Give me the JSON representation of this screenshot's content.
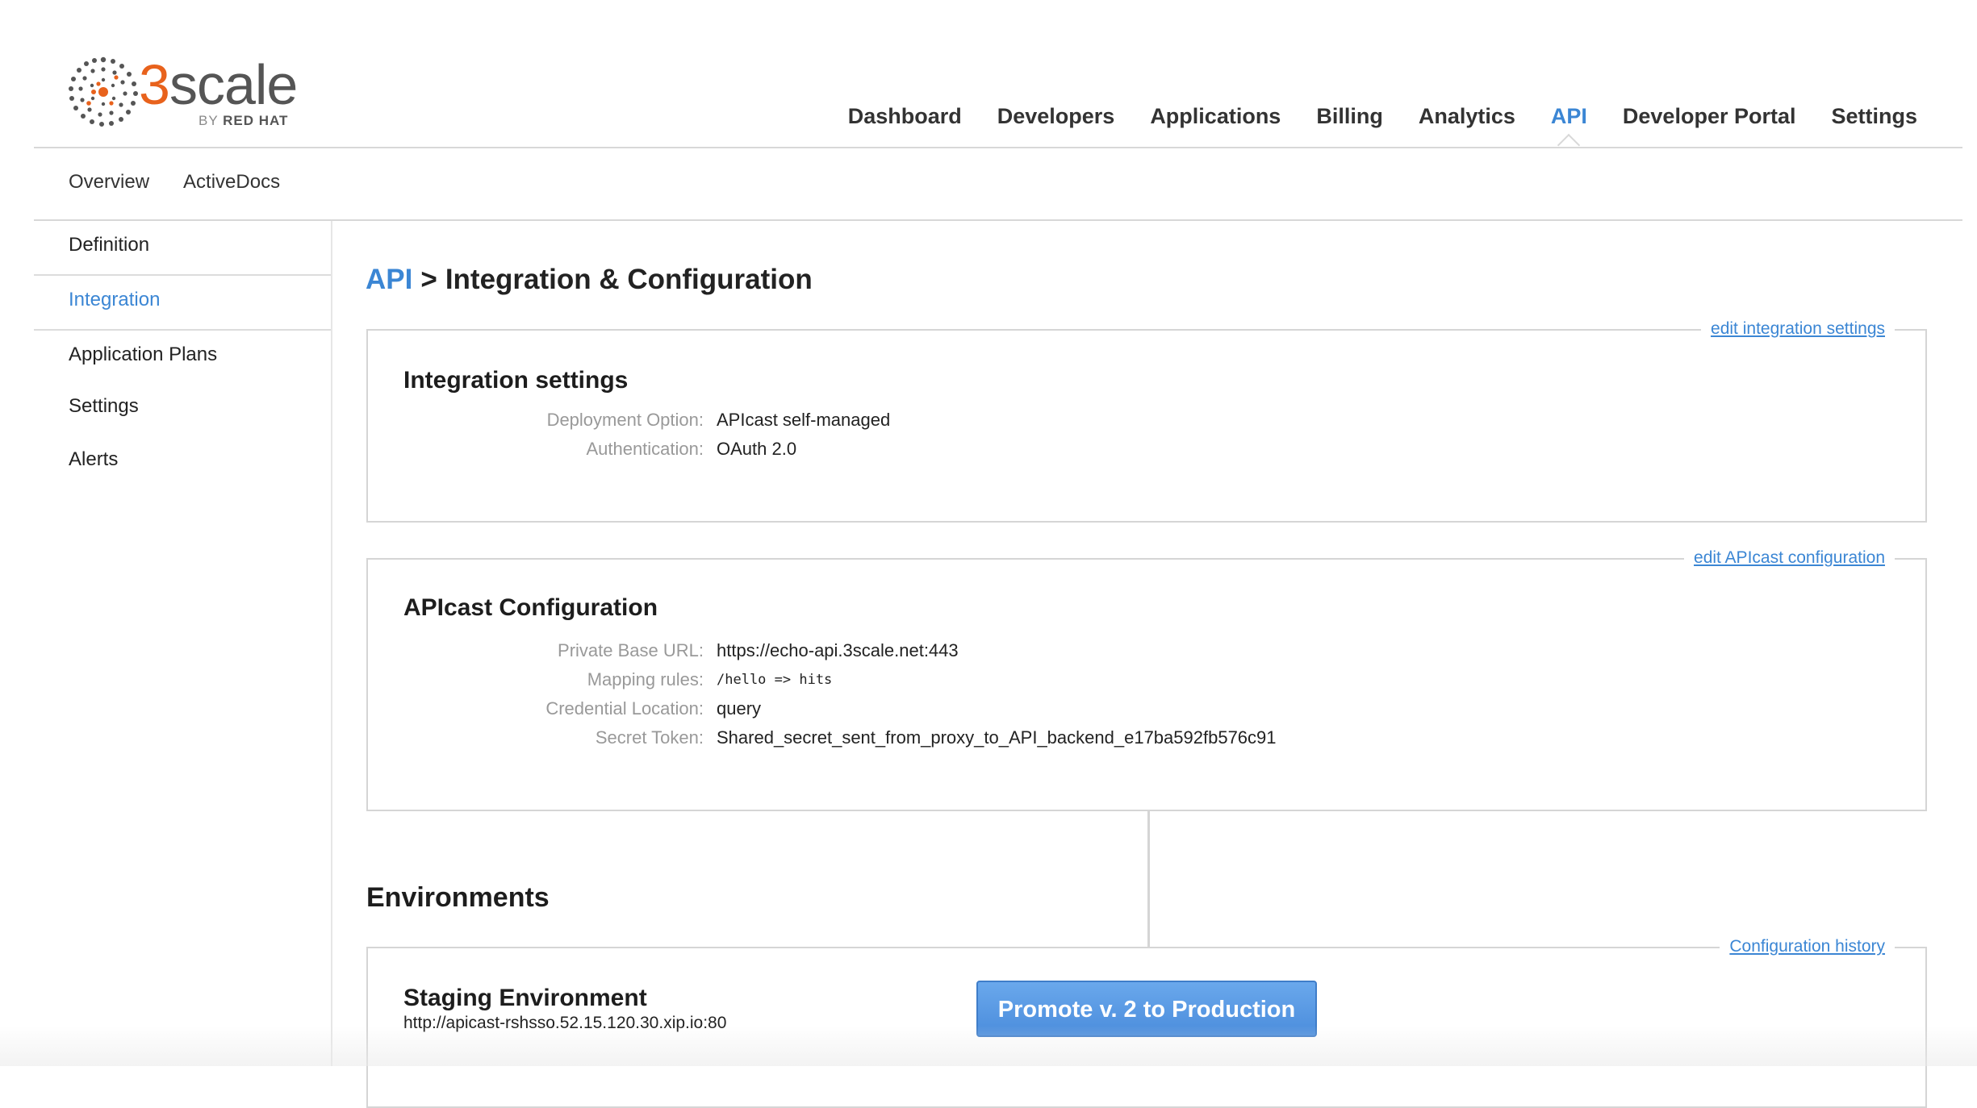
{
  "brand": {
    "logo_prefix": "3",
    "logo_suffix": "scale",
    "logo_sub_by": "BY",
    "logo_sub_name": "RED HAT",
    "accent_color": "#3b86d4",
    "logo_color": "#e8621c"
  },
  "topnav": {
    "items": [
      {
        "label": "Dashboard",
        "active": false
      },
      {
        "label": "Developers",
        "active": false
      },
      {
        "label": "Applications",
        "active": false
      },
      {
        "label": "Billing",
        "active": false
      },
      {
        "label": "Analytics",
        "active": false
      },
      {
        "label": "API",
        "active": true
      },
      {
        "label": "Developer Portal",
        "active": false
      },
      {
        "label": "Settings",
        "active": false
      }
    ]
  },
  "subnav": {
    "items": [
      {
        "label": "Overview"
      },
      {
        "label": "ActiveDocs"
      }
    ]
  },
  "sidebar": {
    "items": [
      {
        "label": "Definition",
        "active": false
      },
      {
        "label": "Integration",
        "active": true
      },
      {
        "label": "Application Plans",
        "active": false
      },
      {
        "label": "Settings",
        "active": false
      },
      {
        "label": "Alerts",
        "active": false
      }
    ]
  },
  "breadcrumb": {
    "root": "API",
    "separator": ">",
    "current": "Integration & Configuration"
  },
  "integration_settings": {
    "title": "Integration settings",
    "edit_link": "edit integration settings",
    "fields": [
      {
        "label": "Deployment Option:",
        "value": "APIcast self-managed"
      },
      {
        "label": "Authentication:",
        "value": "OAuth 2.0"
      }
    ]
  },
  "apicast_config": {
    "title": "APIcast Configuration",
    "edit_link": "edit APIcast configuration",
    "fields": [
      {
        "label": "Private Base URL:",
        "value": "https://echo-api.3scale.net:443"
      },
      {
        "label": "Mapping rules:",
        "value": "/hello => hits"
      },
      {
        "label": "Credential Location:",
        "value": "query"
      },
      {
        "label": "Secret Token:",
        "value": "Shared_secret_sent_from_proxy_to_API_backend_e17ba592fb576c91"
      }
    ]
  },
  "environments": {
    "title": "Environments",
    "history_link": "Configuration history",
    "staging": {
      "title": "Staging Environment",
      "url": "http://apicast-rshsso.52.15.120.30.xip.io:80",
      "promote_label": "Promote v. 2 to Production"
    }
  }
}
